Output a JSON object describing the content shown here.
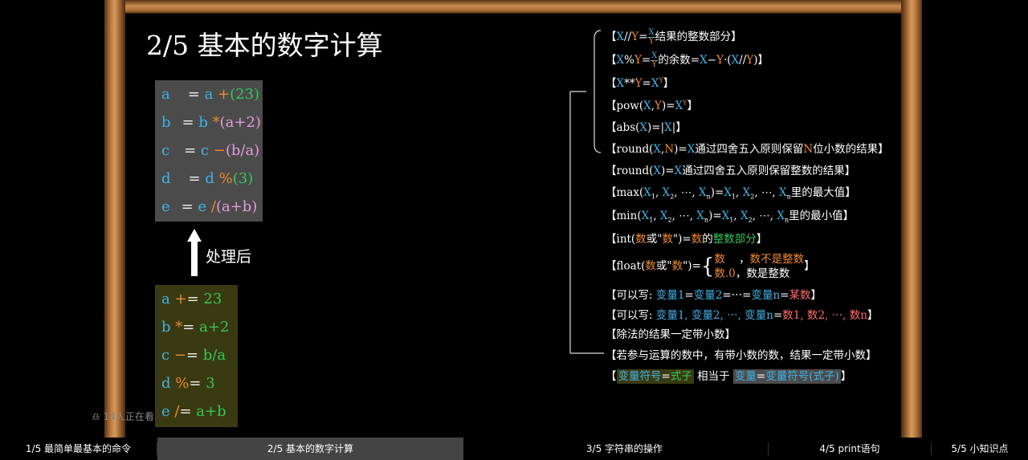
{
  "slide": {
    "title": "2/5 基本的数字计算"
  },
  "operations": [
    {
      "var": "a",
      "eq": "=",
      "rhs_var": "a",
      "op": "+",
      "operand": "(23)"
    },
    {
      "var": "b",
      "eq": "=",
      "rhs_var": "b",
      "op": "*",
      "operand": "(a+2)"
    },
    {
      "var": "c",
      "eq": "=",
      "rhs_var": "c",
      "op": "−",
      "operand": "(b/a)"
    },
    {
      "var": "d",
      "eq": "=",
      "rhs_var": "d",
      "op": "%",
      "operand": "(3)"
    },
    {
      "var": "e",
      "eq": "=",
      "rhs_var": "e",
      "op": "/",
      "operand": "(a+b)"
    }
  ],
  "process_label": "处理后",
  "augmented": [
    {
      "var": "a",
      "op": "+",
      "eq": "=",
      "operand": "23"
    },
    {
      "var": "b",
      "op": "*",
      "eq": "=",
      "operand": "a+2"
    },
    {
      "var": "c",
      "op": "−",
      "eq": "=",
      "operand": "b/a"
    },
    {
      "var": "d",
      "op": "%",
      "eq": "=",
      "operand": "3"
    },
    {
      "var": "e",
      "op": "/",
      "eq": "=",
      "operand": "a+b"
    }
  ],
  "rules": {
    "floordiv_tail": "结果的整数部分】",
    "mod_tail": "的余数=",
    "pow_func": "pow",
    "abs_func": "abs",
    "round_n_tail": "通过四舍五入原则保留",
    "round_n_tail2": "位小数的结果】",
    "round_tail": "通过四舍五入原则保留整数的结果】",
    "max_tail": "里的最大值】",
    "min_tail": "里的最小值】",
    "int_text": "数",
    "int_or": "或\"",
    "int_result": "整数部分",
    "float_case1_a": "数",
    "float_case1_b": "数不是整数",
    "float_case2_a": "数.0",
    "float_case2_b": "数是整数",
    "chain_prefix": "【可以写: ",
    "chain_v1": "变量1",
    "chain_v2": "变量2",
    "chain_dots": "=⋯=",
    "chain_vn": "变量n",
    "chain_val": "某数",
    "multi_prefix": "【可以写: ",
    "multi_vars": "变量1, 变量2, ⋯, 变量n",
    "multi_vals": "数1, 数2, ⋯, 数n",
    "division_note": "【除法的结果一定带小数】",
    "float_note": "【若参与运算的数中，有带小数的数，结果一定带小数】",
    "equiv_left_var": "变量符号",
    "equiv_left_expr": "式子",
    "equiv_middle": "相当于",
    "equiv_right_var": "变量",
    "equiv_right_expr": "变量符号(式子)"
  },
  "viewers": "14人正在看",
  "tabs": [
    {
      "label": "1/5 最简单最基本的命令"
    },
    {
      "label": "2/5 基本的数字计算"
    },
    {
      "label": "3/5 字符串的操作"
    },
    {
      "label": "4/5 print语句"
    },
    {
      "label": "5/5 小知识点"
    }
  ],
  "colors": {
    "variable": "#3fb4e8",
    "operator": "#f08a2b",
    "paren": "#e59bdc",
    "number": "#34c759",
    "frame": "#b87a40"
  }
}
